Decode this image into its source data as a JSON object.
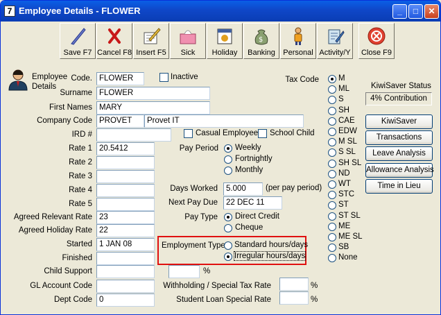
{
  "window": {
    "title": "Employee Details - FLOWER"
  },
  "titlebar_buttons": {
    "minimize": "_",
    "maximize": "□",
    "close": "✕"
  },
  "toolbar": [
    {
      "id": "save",
      "label": "Save F7"
    },
    {
      "id": "cancel",
      "label": "Cancel F8"
    },
    {
      "id": "insert",
      "label": "Insert F5"
    },
    {
      "id": "sick",
      "label": "Sick"
    },
    {
      "id": "holiday",
      "label": "Holiday"
    },
    {
      "id": "banking",
      "label": "Banking"
    },
    {
      "id": "personal",
      "label": "Personal"
    },
    {
      "id": "activity",
      "label": "Activity/Y"
    },
    {
      "id": "close",
      "label": "Close F9"
    }
  ],
  "header_label": "Employee\nDetails",
  "form": {
    "code": {
      "label": "Code.",
      "value": "FLOWER"
    },
    "inactive": {
      "label": "Inactive",
      "checked": false
    },
    "surname": {
      "label": "Surname",
      "value": "FLOWER"
    },
    "first_names": {
      "label": "First Names",
      "value": "MARY"
    },
    "company_code": {
      "label": "Company Code",
      "value": "PROVET",
      "name": "Provet IT"
    },
    "ird": {
      "label": "IRD #",
      "value": ""
    },
    "casual_employee": {
      "label": "Casual Employee",
      "checked": false
    },
    "school_child": {
      "label": "School Child",
      "checked": false
    },
    "rate1": {
      "label": "Rate 1",
      "value": "20.5412"
    },
    "rate2": {
      "label": "Rate 2",
      "value": ""
    },
    "rate3": {
      "label": "Rate 3",
      "value": ""
    },
    "rate4": {
      "label": "Rate 4",
      "value": ""
    },
    "rate5": {
      "label": "Rate 5",
      "value": ""
    },
    "agreed_relevant_rate": {
      "label": "Agreed Relevant Rate",
      "value": "23"
    },
    "agreed_holiday_rate": {
      "label": "Agreed Holiday Rate",
      "value": "22"
    },
    "started": {
      "label": "Started",
      "value": "1 JAN 08"
    },
    "finished": {
      "label": "Finished",
      "value": ""
    },
    "child_support": {
      "label": "Child Support",
      "value": "",
      "pct_value": "",
      "pct_sign": "%"
    },
    "gl_account_code": {
      "label": "GL Account Code",
      "value": ""
    },
    "dept_code": {
      "label": "Dept Code",
      "value": "0"
    },
    "pay_period": {
      "label": "Pay Period",
      "options": [
        "Weekly",
        "Fortnightly",
        "Monthly"
      ],
      "selected": "Weekly"
    },
    "days_worked": {
      "label": "Days Worked",
      "value": "5.000",
      "suffix": "(per pay period)"
    },
    "next_pay_due": {
      "label": "Next Pay Due",
      "value": "22 DEC 11"
    },
    "pay_type": {
      "label": "Pay Type",
      "options": [
        "Direct Credit",
        "Cheque"
      ],
      "selected": "Direct Credit"
    },
    "employment_type": {
      "label": "Employment Type",
      "options": [
        "Standard hours/days",
        "Irregular hours/days"
      ],
      "selected": "Irregular hours/days"
    },
    "withholding_rate": {
      "label": "Withholding / Special Tax Rate",
      "value": "",
      "pct_sign": "%"
    },
    "student_loan_rate": {
      "label": "Student Loan Special Rate",
      "value": "",
      "pct_sign": "%"
    }
  },
  "tax_code": {
    "label": "Tax Code",
    "options": [
      "M",
      "ML",
      "S",
      "SH",
      "CAE",
      "EDW",
      "M SL",
      "S SL",
      "SH SL",
      "ND",
      "WT",
      "STC",
      "ST",
      "ST SL",
      "ME",
      "ME SL",
      "SB",
      "None"
    ],
    "selected": "M"
  },
  "kiwisaver": {
    "label": "KiwiSaver Status",
    "value": "4% Contribution"
  },
  "side_buttons": [
    "KiwiSaver",
    "Transactions",
    "Leave Analysis",
    "Allowance Analysis",
    "Time in Lieu"
  ],
  "colors": {
    "titlebar": "#0A5FE6",
    "highlight_box": "#E01010",
    "window_bg": "#ECE9D8"
  }
}
